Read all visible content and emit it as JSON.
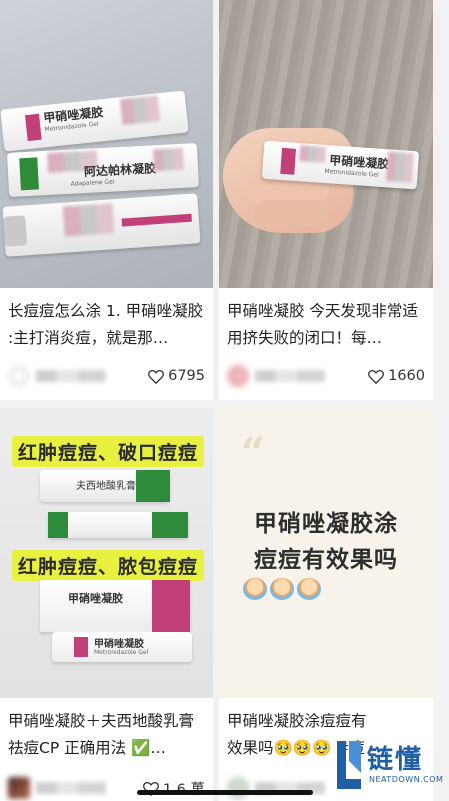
{
  "feed": {
    "cards": [
      {
        "title": "长痘痘怎么涂 1. 甲硝唑凝胶 :主打消炎痘，就是那…",
        "likes": "6795",
        "image": {
          "tube1_label": "甲硝唑凝胶",
          "tube1_sub": "Metronidazole Gel",
          "tube2_label": "阿达帕林凝胶",
          "tube2_sub": "Adapalene Gel"
        }
      },
      {
        "title": "甲硝唑凝胶 今天发现非常适用挤失败的闭口！每…",
        "likes": "1660",
        "image": {
          "tube_label": "甲硝唑凝胶",
          "tube_sub": "Metronidazole Gel"
        }
      },
      {
        "title": "甲硝唑凝胶＋夫西地酸乳膏 祛痘CP 正确用法 ✅…",
        "likes": "1.6 萬",
        "image": {
          "banner1": "红肿痘痘、破口痘痘",
          "banner2": "红肿痘痘、脓包痘痘",
          "tube1_label": "夫西地酸乳膏",
          "box_label": "甲硝唑凝胶",
          "tube2_label": "甲硝唑凝胶",
          "tube2_sub": "Metronidazole Gel"
        }
      },
      {
        "title": "甲硝唑凝胶涂痘痘有效果吗🥹🥹🥹 #痘",
        "likes": "",
        "image": {
          "line1": "甲硝唑凝胶涂",
          "line2": "痘痘有效果吗",
          "quote_mark": "“"
        }
      }
    ]
  },
  "watermark": {
    "brand_cn": "链懂",
    "brand_en": "NEATDOWN.COM"
  },
  "colors": {
    "accent_blue": "#1e5fa8",
    "highlight_yellow": "#e8f040",
    "pink_tube": "#c2407a"
  }
}
